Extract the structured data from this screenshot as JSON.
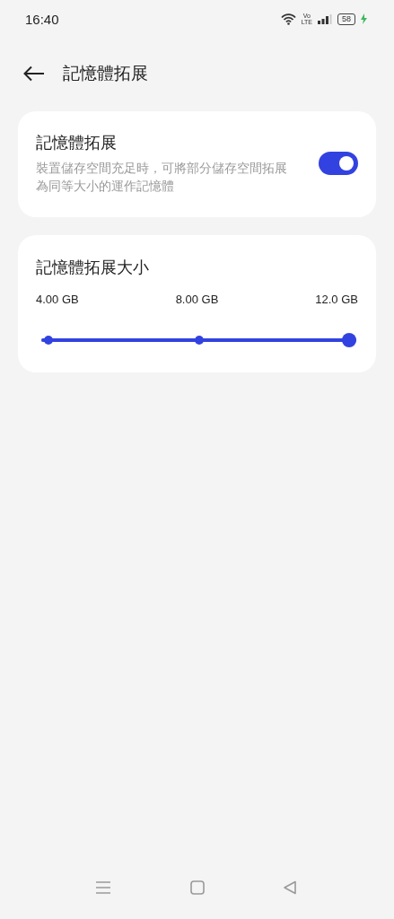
{
  "status_bar": {
    "time": "16:40",
    "volte": [
      "Vo",
      "LTE"
    ],
    "battery": "58",
    "charging": true
  },
  "header": {
    "title": "記憶體拓展"
  },
  "toggle_card": {
    "title": "記憶體拓展",
    "description": "裝置儲存空間充足時，可將部分儲存空間拓展為同等大小的運作記憶體",
    "on": true
  },
  "size_card": {
    "title": "記憶體拓展大小",
    "labels": [
      "4.00 GB",
      "8.00 GB",
      "12.0 GB"
    ],
    "level": 1
  }
}
